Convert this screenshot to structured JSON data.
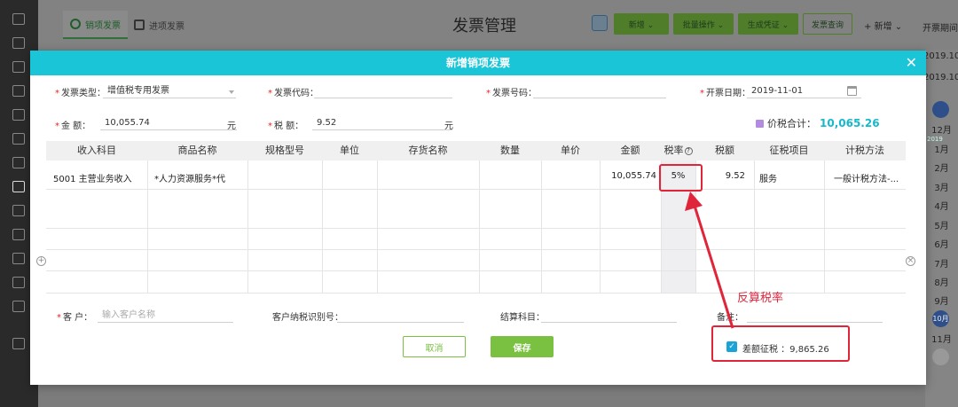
{
  "app": {
    "tabs": [
      {
        "label": "销项发票",
        "icon": "invoice-logo-icon"
      },
      {
        "label": "进项发票",
        "icon": "hand-invoice-icon"
      }
    ],
    "page_title": "发票管理",
    "toolbar": {
      "add_label": "新增 ⌄",
      "batch_label": "批量操作 ⌄",
      "generate_label": "生成凭证 ⌄",
      "export_label": "发票查询",
      "new_menu_label": "+ 新增 ⌄",
      "period_label": "开票期间"
    },
    "right_panel": {
      "dates": [
        "2019.10",
        "2019.10"
      ],
      "year_badge": "2019",
      "months": [
        "12月",
        "1月",
        "2月",
        "3月",
        "4月",
        "5月",
        "6月",
        "7月",
        "8月",
        "9月",
        "10月",
        "11月"
      ],
      "active_month": "10月"
    }
  },
  "modal": {
    "title": "新增销项发票",
    "form": {
      "invoice_type_label": "发票类型：",
      "invoice_type_value": "增值税专用发票",
      "invoice_code_label": "发票代码：",
      "invoice_code_value": "",
      "invoice_number_label": "发票号码：",
      "invoice_number_value": "",
      "issue_date_label": "开票日期：",
      "issue_date_value": "2019-11-01",
      "amount_label": "金    额：",
      "amount_value": "10,055.74",
      "amount_unit": "元",
      "tax_label": "税    额：",
      "tax_value": "9.52",
      "tax_unit": "元",
      "total_label": "价税合计：",
      "total_value": "10,065.26"
    },
    "table": {
      "headers": [
        "收入科目",
        "商品名称",
        "规格型号",
        "单位",
        "存货名称",
        "数量",
        "单价",
        "金额",
        "税率",
        "税额",
        "征税项目",
        "计税方法"
      ],
      "rows": [
        {
          "subject": "5001 主营业务收入",
          "product": "*人力资源服务*代",
          "spec": "",
          "unit": "",
          "inventory": "",
          "qty": "",
          "price": "",
          "amount": "10,055.74",
          "rate": "5%",
          "tax": "9.52",
          "tax_item": "服务",
          "method": "一般计税方法-..."
        }
      ]
    },
    "footer": {
      "customer_label": "客    户：",
      "customer_placeholder": "输入客户名称",
      "taxpayer_id_label": "客户纳税识别号：",
      "taxpayer_id_value": "",
      "settlement_label": "结算科目：",
      "settlement_value": "",
      "remark_label": "备注：",
      "remark_value": "",
      "cancel_label": "取消",
      "save_label": "保存",
      "diff_tax_label": "差额征税 ：9,865.26",
      "diff_tax_checked": true
    }
  },
  "annotation": {
    "label": "反算税率",
    "color": "#e0253b"
  }
}
